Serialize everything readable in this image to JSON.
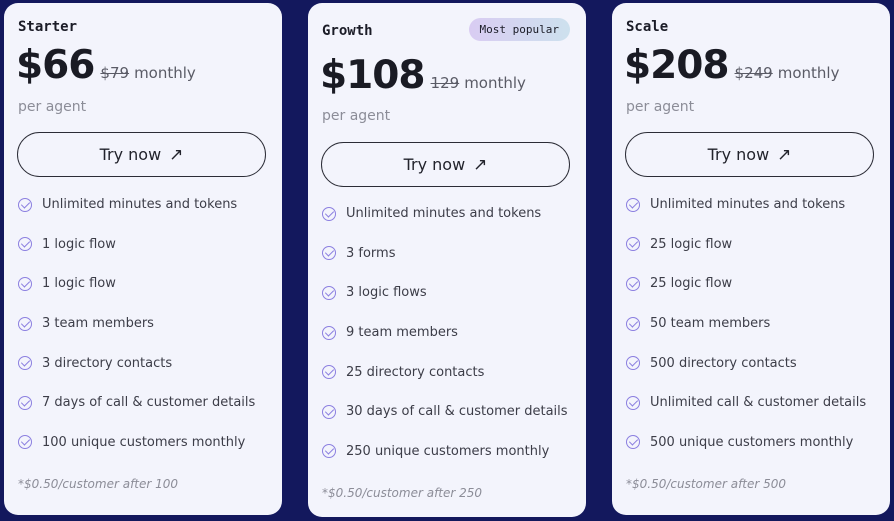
{
  "plans": [
    {
      "name": "Starter",
      "price": "$66",
      "old_price": "$79",
      "period": "monthly",
      "unit": "per agent",
      "button": "Try now",
      "features": [
        "Unlimited minutes and tokens",
        "1 logic flow",
        "1 logic flow",
        "3 team members",
        "3 directory contacts",
        "7 days of call & customer details",
        "100 unique customers monthly"
      ],
      "footnote": "*$0.50/customer after 100"
    },
    {
      "name": "Growth",
      "badge": "Most popular",
      "price": "$108",
      "old_price": "129",
      "period": "monthly",
      "unit": "per agent",
      "button": "Try now",
      "features": [
        "Unlimited minutes and tokens",
        "3 forms",
        "3 logic flows",
        "9 team members",
        "25 directory contacts",
        "30 days of call & customer details",
        "250 unique customers monthly"
      ],
      "footnote": "*$0.50/customer after 250"
    },
    {
      "name": "Scale",
      "price": "$208",
      "old_price": "$249",
      "period": "monthly",
      "unit": "per agent",
      "button": "Try now",
      "features": [
        "Unlimited minutes and tokens",
        "25 logic flow",
        "25 logic flow",
        "50 team members",
        "500 directory contacts",
        "Unlimited call & customer details",
        "500 unique customers monthly"
      ],
      "footnote": "*$0.50/customer after 500"
    }
  ],
  "icons": {
    "button_arrow": "arrow-up-right-icon",
    "feature_check": "check-circle-icon"
  },
  "colors": {
    "background": "#13185d",
    "card": "#f3f4fc",
    "check": "#8b7fe0",
    "badge_from": "#d9ccf2",
    "badge_to": "#cde1ee"
  }
}
